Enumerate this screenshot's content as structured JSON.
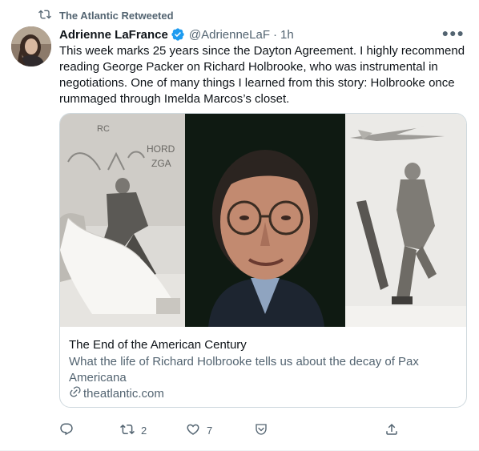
{
  "retweet_banner": {
    "icon": "retweet-icon",
    "label": "The Atlantic Retweeted"
  },
  "author": {
    "name": "Adrienne LaFrance",
    "verified_icon": "verified-badge-icon",
    "handle": "@AdrienneLaF",
    "separator": "·",
    "time": "1h"
  },
  "more_icon": "more-icon",
  "tweet": {
    "text": "This week marks 25 years since the Dayton Agreement. I highly recommend reading George Packer on Richard Holbrooke, who was instrumental in negotiations. One of many things I learned from this story: Holbrooke once rummaged through Imelda Marcos’s closet."
  },
  "card": {
    "image_icon": "collage-photo",
    "wall_text": {
      "line1": "RC",
      "line2": "HORD",
      "line3": "ZGA"
    },
    "title": "The End of the American Century",
    "description": "What the life of Richard Holbrooke tells us about the decay of Pax Americana",
    "domain": "theatlantic.com",
    "link_icon": "link-icon"
  },
  "actions": {
    "reply": {
      "icon": "reply-icon",
      "count": ""
    },
    "retweet": {
      "icon": "retweet-icon",
      "count": "2"
    },
    "like": {
      "icon": "heart-icon",
      "count": "7"
    },
    "save": {
      "icon": "save-icon"
    },
    "share": {
      "icon": "share-icon"
    }
  },
  "colors": {
    "verified": "#1d9bf0",
    "secondary_text": "#536471",
    "border": "#cfd9de"
  }
}
